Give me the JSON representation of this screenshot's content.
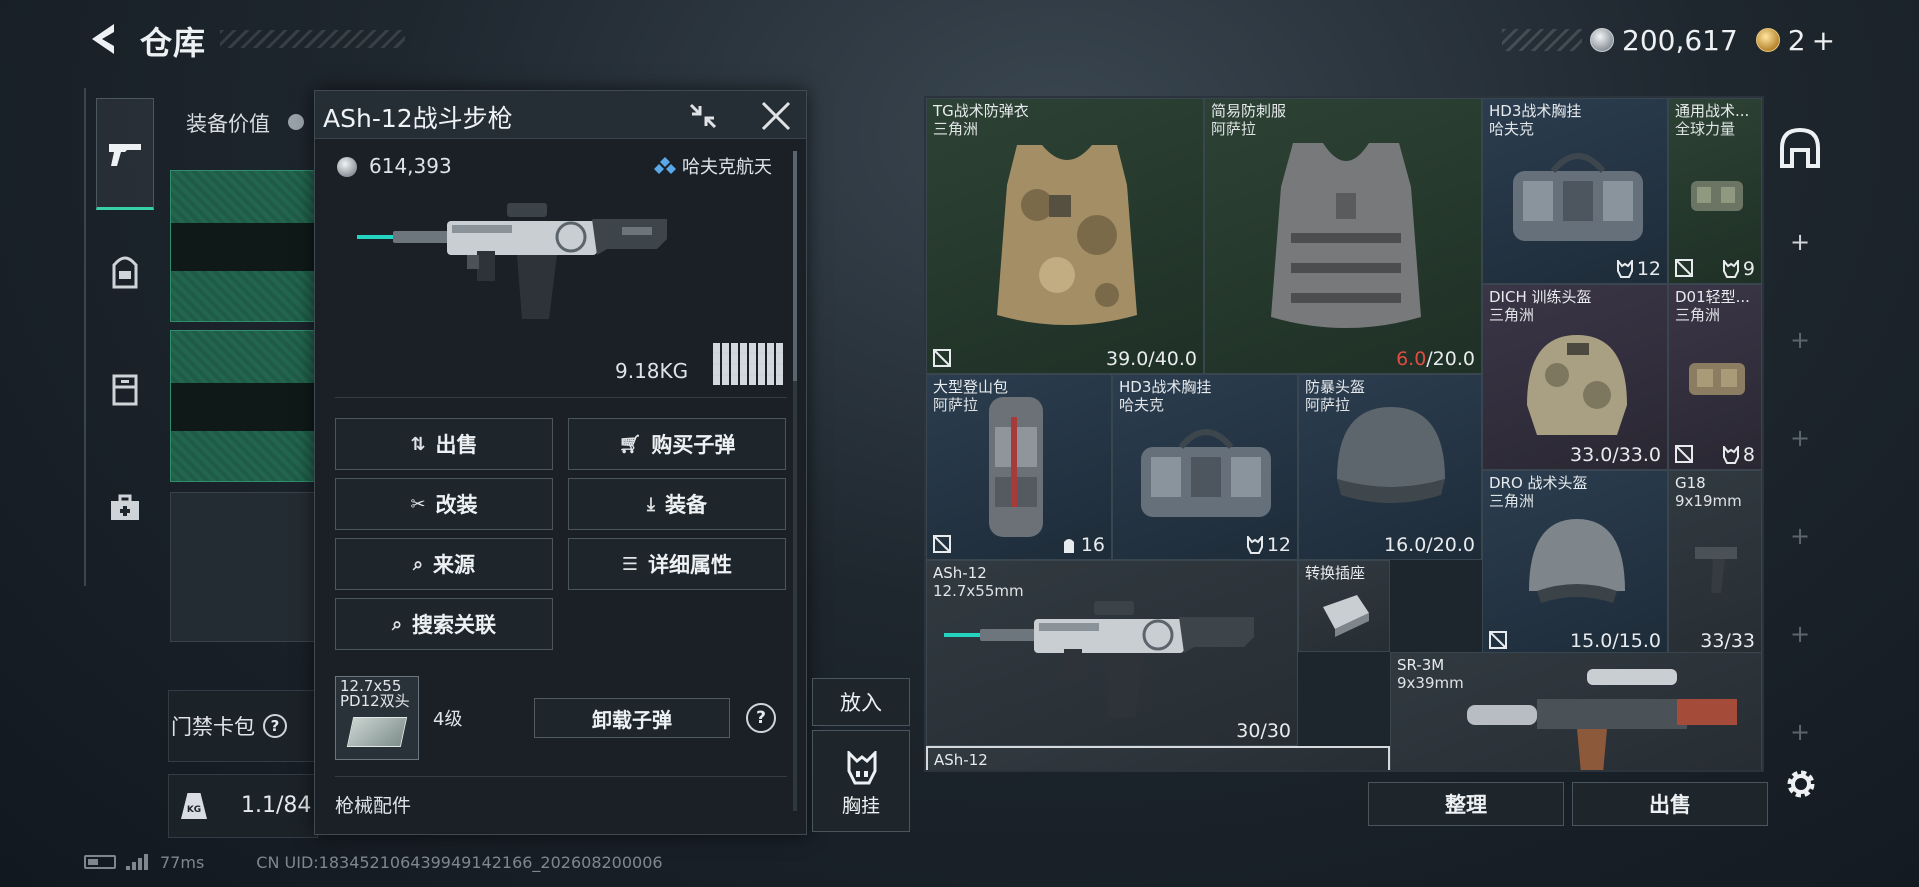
{
  "header": {
    "title": "仓库",
    "currency_main": "200,617",
    "currency_premium": "2",
    "premium_plus": "+"
  },
  "left_panel": {
    "equip_value_label": "装备价值",
    "keycard_label": "门禁卡包",
    "keycard_help": "?",
    "weight_value": "1.1/84"
  },
  "nav": {
    "items": [
      {
        "name": "weapons",
        "icon": "pistol-icon",
        "active": true
      },
      {
        "name": "gear",
        "icon": "backpack-icon",
        "active": false
      },
      {
        "name": "storage",
        "icon": "locker-icon",
        "active": false
      },
      {
        "name": "supplies",
        "icon": "medkit-icon",
        "active": false
      }
    ]
  },
  "popup": {
    "title": "ASh-12战斗步枪",
    "price": "614,393",
    "maker": "哈夫克航天",
    "weight": "9.18KG",
    "actions": {
      "sell": "出售",
      "buy_ammo": "购买子弹",
      "modify": "改装",
      "equip": "装备",
      "source": "来源",
      "details": "详细属性",
      "search_related": "搜索关联"
    },
    "ammo": {
      "name_line1": "12.7x55",
      "name_line2": "PD12双头",
      "level": "4级",
      "unload": "卸载子弹",
      "help": "?"
    },
    "attachments_label": "枪械配件"
  },
  "put_in": {
    "label": "放入",
    "rig_label": "胸挂"
  },
  "storage": {
    "items": [
      {
        "id": "tg-vest",
        "name": "TG战术防弹衣",
        "sub": "三角洲",
        "value": "39.0/40.0",
        "rarity": "green"
      },
      {
        "id": "stab-vest",
        "name": "简易防刺服",
        "sub": "阿萨拉",
        "value_red": "6.0",
        "value_rest": "/20.0",
        "rarity": "green"
      },
      {
        "id": "hd3-rig-a",
        "name": "HD3战术胸挂",
        "sub": "哈夫克",
        "count": "12",
        "rarity": "blue"
      },
      {
        "id": "gen-rig",
        "name": "通用战术...",
        "sub": "全球力量",
        "count": "9",
        "rarity": "green"
      },
      {
        "id": "dich-helmet",
        "name": "DICH 训练头盔",
        "sub": "三角洲",
        "value": "33.0/33.0",
        "rarity": "purple"
      },
      {
        "id": "d01-light",
        "name": "D01轻型...",
        "sub": "三角洲",
        "count": "8",
        "rarity": "purple"
      },
      {
        "id": "hiking-pack",
        "name": "大型登山包",
        "sub": "阿萨拉",
        "count": "16",
        "rarity": "blue"
      },
      {
        "id": "hd3-rig-b",
        "name": "HD3战术胸挂",
        "sub": "哈夫克",
        "count": "12",
        "rarity": "blue"
      },
      {
        "id": "riot-helmet",
        "name": "防暴头盔",
        "sub": "阿萨拉",
        "value": "16.0/20.0",
        "rarity": "blue"
      },
      {
        "id": "dro-helmet",
        "name": "DRO 战术头盔",
        "sub": "三角洲",
        "value": "15.0/15.0",
        "rarity": "blue"
      },
      {
        "id": "g18",
        "name": "G18",
        "sub": "9x19mm",
        "value": "33/33",
        "rarity": "gray"
      },
      {
        "id": "ash12-stored",
        "name": "ASh-12",
        "sub": "12.7x55mm",
        "value": "30/30",
        "rarity": "gray"
      },
      {
        "id": "adapter",
        "name": "转换插座",
        "sub": "",
        "rarity": "gray"
      },
      {
        "id": "sr3m",
        "name": "SR-3M",
        "sub": "9x39mm",
        "rarity": "gray"
      },
      {
        "id": "ash12-selected",
        "name": "ASh-12",
        "sub": "",
        "rarity": "gray"
      }
    ]
  },
  "bottom": {
    "organize": "整理",
    "sell": "出售"
  },
  "status": {
    "ping": "77ms",
    "uid": "CN UID:1834521064399491421​66_202608200006"
  },
  "colors": {
    "accent_teal": "#38d0a8",
    "red_durability": "#e04b43",
    "rarity_green": "#2d4234",
    "rarity_blue": "#2b3d4f",
    "rarity_purple": "#3b3647"
  }
}
